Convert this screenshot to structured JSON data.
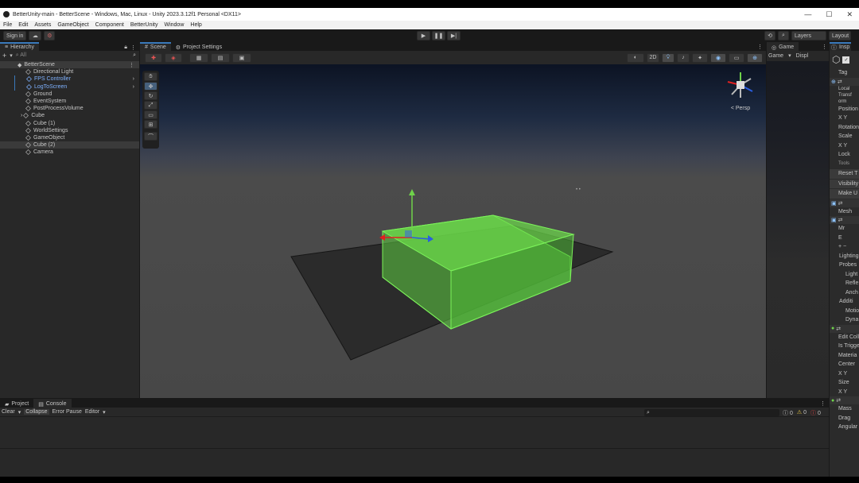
{
  "window": {
    "title": "BetterUnity-main - BetterScene - Windows, Mac, Linux - Unity 2023.3.12f1 Personal <DX11>",
    "controls": [
      "—",
      "☐",
      "✕"
    ]
  },
  "menu": [
    "File",
    "Edit",
    "Assets",
    "GameObject",
    "Component",
    "BetterUnity",
    "Window",
    "Help"
  ],
  "toolbar": {
    "signin": "Sign in",
    "layers": "Layers",
    "layout": "Layout"
  },
  "hierarchy": {
    "tab": "Hierarchy",
    "search_hint": "All",
    "scene": "BetterScene",
    "items": [
      "Directional Light",
      "FPS Controller",
      "LogToScreen",
      "Ground",
      "EventSystem",
      "PostProcessVolume",
      "Cube",
      "Cube (1)",
      "WorldSettings",
      "GameObject",
      "Cube (2)",
      "Camera"
    ]
  },
  "scene": {
    "tab": "Scene",
    "tab2": "Project Settings",
    "mode2d": "2D",
    "persp": "< Persp"
  },
  "game": {
    "tab": "Game",
    "display": "Game",
    "display2": "Displ"
  },
  "inspector": {
    "tab": "Insp",
    "rows": [
      "Tag",
      "Local",
      "Transf",
      "orm",
      "Position",
      "X  Y",
      "Rotation",
      "Scale",
      "X  Y",
      "Lock",
      "Tools",
      "Reset T",
      "Visibility",
      "Make U",
      "Mesh",
      "Mr",
      "E",
      "+  −",
      "Lighting",
      "Probes",
      "Light",
      "Refle",
      "Anch",
      "Additi",
      "Motio",
      "Dyna",
      "Edit Coll",
      "Is Trigge",
      "Materia",
      "Center",
      "X  Y",
      "Size",
      "X  Y",
      "Mass",
      "Drag",
      "Angular"
    ]
  },
  "console": {
    "tab1": "Project",
    "tab2": "Console",
    "clear": "Clear",
    "collapse": "Collapse",
    "errorpause": "Error Pause",
    "editor": "Editor",
    "c1": "0",
    "c2": "0",
    "c3": "0"
  },
  "colors": {
    "accent": "#3a79bb",
    "selection": "#7fb2ff",
    "cube": "#5fd041",
    "ground": "#2b2b2b"
  }
}
